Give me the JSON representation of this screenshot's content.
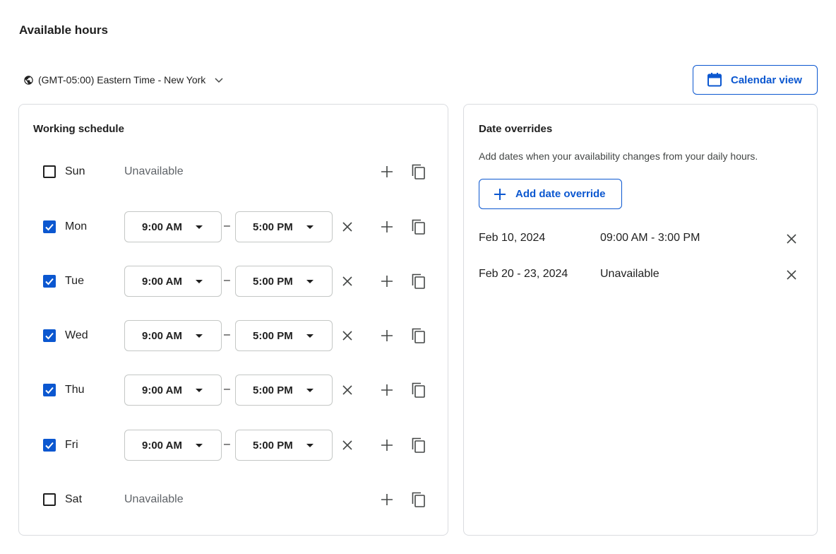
{
  "page": {
    "title": "Available hours"
  },
  "timezone": {
    "label": "(GMT-05:00) Eastern Time - New York",
    "icon": "globe-icon"
  },
  "calendar_button": {
    "label": "Calendar view",
    "icon": "calendar-icon"
  },
  "schedule": {
    "title": "Working schedule",
    "unavailable_label": "Unavailable",
    "separator": "–",
    "days": [
      {
        "day": "Sun",
        "checked": false,
        "status": "Unavailable"
      },
      {
        "day": "Mon",
        "checked": true,
        "start": "9:00 AM",
        "end": "5:00 PM"
      },
      {
        "day": "Tue",
        "checked": true,
        "start": "9:00 AM",
        "end": "5:00 PM"
      },
      {
        "day": "Wed",
        "checked": true,
        "start": "9:00 AM",
        "end": "5:00 PM"
      },
      {
        "day": "Thu",
        "checked": true,
        "start": "9:00 AM",
        "end": "5:00 PM"
      },
      {
        "day": "Fri",
        "checked": true,
        "start": "9:00 AM",
        "end": "5:00 PM"
      },
      {
        "day": "Sat",
        "checked": false,
        "status": "Unavailable"
      }
    ]
  },
  "overrides": {
    "title": "Date overrides",
    "description": "Add dates when your availability changes from your daily hours.",
    "add_button": "Add date override",
    "items": [
      {
        "date": "Feb 10, 2024",
        "value": "09:00 AM - 3:00 PM"
      },
      {
        "date": "Feb 20 - 23, 2024",
        "value": "Unavailable"
      }
    ]
  },
  "colors": {
    "accent": "#0b57d0",
    "border": "#dadce0",
    "text": "#1f1f1f",
    "muted": "#5f6368"
  }
}
